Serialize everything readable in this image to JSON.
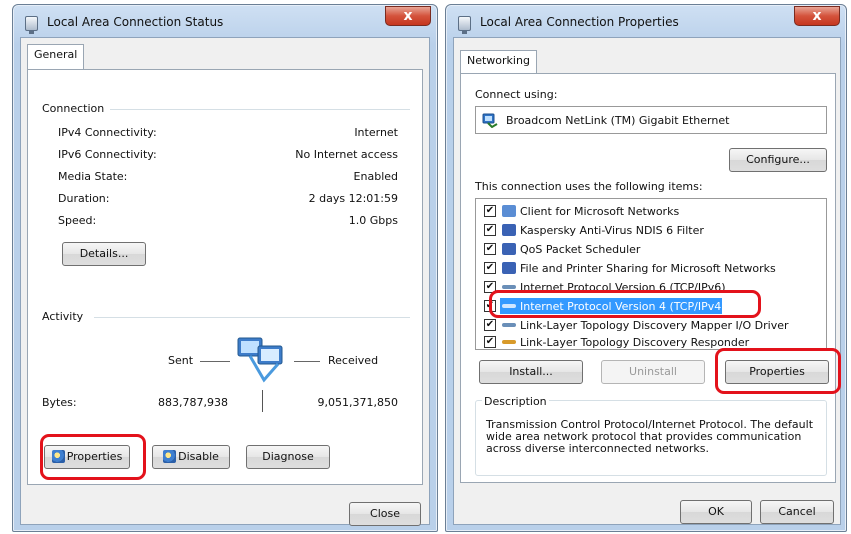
{
  "status_window": {
    "title": "Local Area Connection Status",
    "close_glyph": "x",
    "tab": "General",
    "connection_heading": "Connection",
    "rows": [
      {
        "label": "IPv4 Connectivity:",
        "value": "Internet"
      },
      {
        "label": "IPv6 Connectivity:",
        "value": "No Internet access"
      },
      {
        "label": "Media State:",
        "value": "Enabled"
      },
      {
        "label": "Duration:",
        "value": "2 days 12:01:59"
      },
      {
        "label": "Speed:",
        "value": "1.0 Gbps"
      }
    ],
    "details_button": "Details...",
    "activity_heading": "Activity",
    "sent_label": "Sent",
    "received_label": "Received",
    "bytes_label": "Bytes:",
    "bytes_sent": "883,787,938",
    "bytes_received": "9,051,371,850",
    "properties_button": "Properties",
    "disable_button": "Disable",
    "diagnose_button": "Diagnose",
    "close_button": "Close"
  },
  "properties_window": {
    "title": "Local Area Connection Properties",
    "close_glyph": "x",
    "tab": "Networking",
    "connect_using_label": "Connect using:",
    "adapter_name": "Broadcom NetLink (TM) Gigabit Ethernet",
    "configure_button": "Configure...",
    "items_label": "This connection uses the following items:",
    "items": [
      {
        "label": "Client for Microsoft Networks",
        "checked": true,
        "icon": "network-client-icon"
      },
      {
        "label": "Kaspersky Anti-Virus NDIS 6 Filter",
        "checked": true,
        "icon": "network-service-icon"
      },
      {
        "label": "QoS Packet Scheduler",
        "checked": true,
        "icon": "network-service-icon"
      },
      {
        "label": "File and Printer Sharing for Microsoft Networks",
        "checked": true,
        "icon": "network-service-icon"
      },
      {
        "label": "Internet Protocol Version 6 (TCP/IPv6)",
        "checked": true,
        "icon": "protocol-icon"
      },
      {
        "label": "Internet Protocol Version 4 (TCP/IPv4)",
        "checked": true,
        "icon": "protocol-icon",
        "selected": true
      },
      {
        "label": "Link-Layer Topology Discovery Mapper I/O Driver",
        "checked": true,
        "icon": "protocol-icon"
      },
      {
        "label": "Link-Layer Topology Discovery Responder",
        "checked": true,
        "icon": "protocol-icon"
      }
    ],
    "install_button": "Install...",
    "uninstall_button": "Uninstall",
    "properties_button": "Properties",
    "description_heading": "Description",
    "description_text": "Transmission Control Protocol/Internet Protocol. The default wide area network protocol that provides communication across diverse interconnected networks.",
    "ok_button": "OK",
    "cancel_button": "Cancel"
  },
  "colors": {
    "highlight_ring": "#e3121b",
    "selection": "#3399ff"
  }
}
